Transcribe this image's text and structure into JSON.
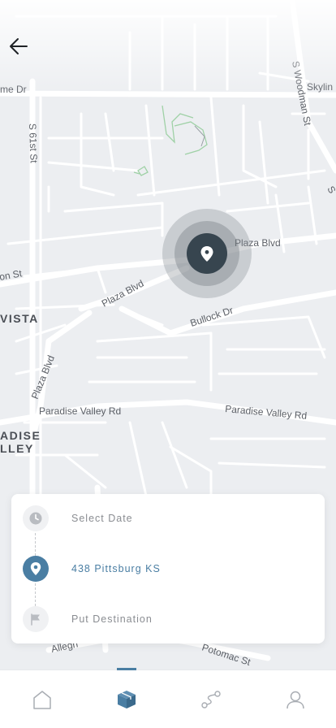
{
  "app": {
    "accent_color": "#4a7ea3",
    "dark_color": "#37454f"
  },
  "header": {
    "back_icon": "arrow-left-icon"
  },
  "map": {
    "streets": {
      "s_woodman_st": "S Woodman St",
      "skyline": "Skylin",
      "s61st": "S 61st St",
      "me_dr": "me Dr",
      "plaza_blvd_1": "Plaza Blvd",
      "plaza_blvd_2": "Plaza Blvd",
      "plaza_blvd_3": "Plaza Blvd",
      "on_st": "on St",
      "bullock_dr": "Bullock Dr",
      "paradise_valley_rd_1": "Paradise Valley Rd",
      "paradise_valley_rd_2": "Paradise Valley Rd",
      "alleg": "Allegh",
      "potomac_st": "Potomac St",
      "s_edge": "S"
    },
    "areas": {
      "vista": "VISTA",
      "adise": "ADISE",
      "lley": "LLEY"
    },
    "pin_icon": "location-pin-icon"
  },
  "route_card": {
    "items": [
      {
        "label": "Select Date",
        "icon": "clock-icon",
        "active": false
      },
      {
        "label": "438 Pittsburg KS",
        "icon": "location-pin-icon",
        "active": true
      },
      {
        "label": "Put Destination",
        "icon": "flag-icon",
        "active": false
      }
    ]
  },
  "tabbar": {
    "tabs": [
      {
        "name": "home",
        "icon": "home-icon",
        "active": false
      },
      {
        "name": "packages",
        "icon": "package-icon",
        "active": true
      },
      {
        "name": "routes",
        "icon": "route-icon",
        "active": false
      },
      {
        "name": "profile",
        "icon": "user-icon",
        "active": false
      }
    ]
  }
}
